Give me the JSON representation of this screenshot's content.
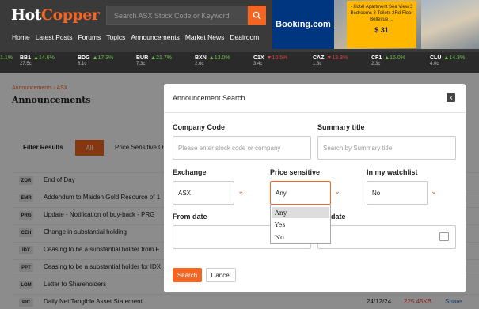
{
  "header": {
    "logo_a": "Hot",
    "logo_b": "Copper",
    "search_placeholder": "Search ASX Stock Code or Keyword",
    "nav": [
      "Home",
      "Latest Posts",
      "Forums",
      "Topics",
      "Announcements",
      "Market News",
      "Dealroom"
    ]
  },
  "ad": {
    "brand": "Booking.com",
    "deal_text": "- Hotel Apartment Sea View 3 Bedrooms 3 Toilets 2Rd Floor Bellevue ...",
    "price": "$ 31"
  },
  "ticker": [
    {
      "code": "1.1%",
      "value": "",
      "change": "",
      "dir": ""
    },
    {
      "code": "BB1",
      "value": "27.5c",
      "change": "▲14.6%",
      "dir": "up"
    },
    {
      "code": "BDG",
      "value": "6.1c",
      "change": "▲17.3%",
      "dir": "up"
    },
    {
      "code": "BUR",
      "value": "7.3c",
      "change": "▲21.7%",
      "dir": "up"
    },
    {
      "code": "BXN",
      "value": "2.6c",
      "change": "▲13.0%",
      "dir": "up"
    },
    {
      "code": "C1X",
      "value": "3.4c",
      "change": "▼10.5%",
      "dir": "dn"
    },
    {
      "code": "CAZ",
      "value": "1.3c",
      "change": "▼13.3%",
      "dir": "dn"
    },
    {
      "code": "CF1",
      "value": "2.3c",
      "change": "▲15.0%",
      "dir": "up"
    },
    {
      "code": "CLU",
      "value": "4.0c",
      "change": "▲14.3%",
      "dir": "up"
    }
  ],
  "breadcrumb": "Announcements   ›   ASX",
  "page_title": "Announcements",
  "filter": {
    "label": "Filter Results",
    "all": "All",
    "price_sensitive": "Price Sensitive Or"
  },
  "rows": [
    {
      "code": "ZOR",
      "title": "End of Day",
      "date": "",
      "size": "",
      "share": ""
    },
    {
      "code": "EMR",
      "title": "Addendum to Maiden Gold Resource of 1",
      "date": "",
      "size": "",
      "share": ""
    },
    {
      "code": "PRG",
      "title": "Update - Notification of buy-back - PRG",
      "date": "",
      "size": "",
      "share": ""
    },
    {
      "code": "CEH",
      "title": "Change in substantial holding",
      "date": "",
      "size": "",
      "share": ""
    },
    {
      "code": "IDX",
      "title": "Ceasing to be a substantial holder from F",
      "date": "",
      "size": "",
      "share": ""
    },
    {
      "code": "PPT",
      "title": "Ceasing to be a substantial holder for IDX",
      "date": "",
      "size": "",
      "share": ""
    },
    {
      "code": "LOM",
      "title": "Letter to Shareholders",
      "date": "",
      "size": "",
      "share": ""
    },
    {
      "code": "PIC",
      "title": "Daily Net Tangible Asset Statement",
      "date": "24/12/24",
      "size": "225.45KB",
      "share": "Share"
    }
  ],
  "modal": {
    "title": "Announcement Search",
    "close": "x",
    "company_code_label": "Company Code",
    "company_code_placeholder": "Please enter stock code or company",
    "summary_label": "Summary title",
    "summary_placeholder": "Search by Summary title",
    "exchange_label": "Exchange",
    "exchange_value": "ASX",
    "price_sensitive_label": "Price sensitive",
    "price_sensitive_value": "Any",
    "watchlist_label": "In my watchlist",
    "watchlist_value": "No",
    "from_date_label": "From date",
    "to_date_label": "date",
    "options": [
      "Any",
      "Yes",
      "No"
    ],
    "search_btn": "Search",
    "cancel_btn": "Cancel"
  },
  "colors": {
    "accent": "#f26522",
    "header": "#3a3a3a",
    "highlight": "#f5f500"
  }
}
